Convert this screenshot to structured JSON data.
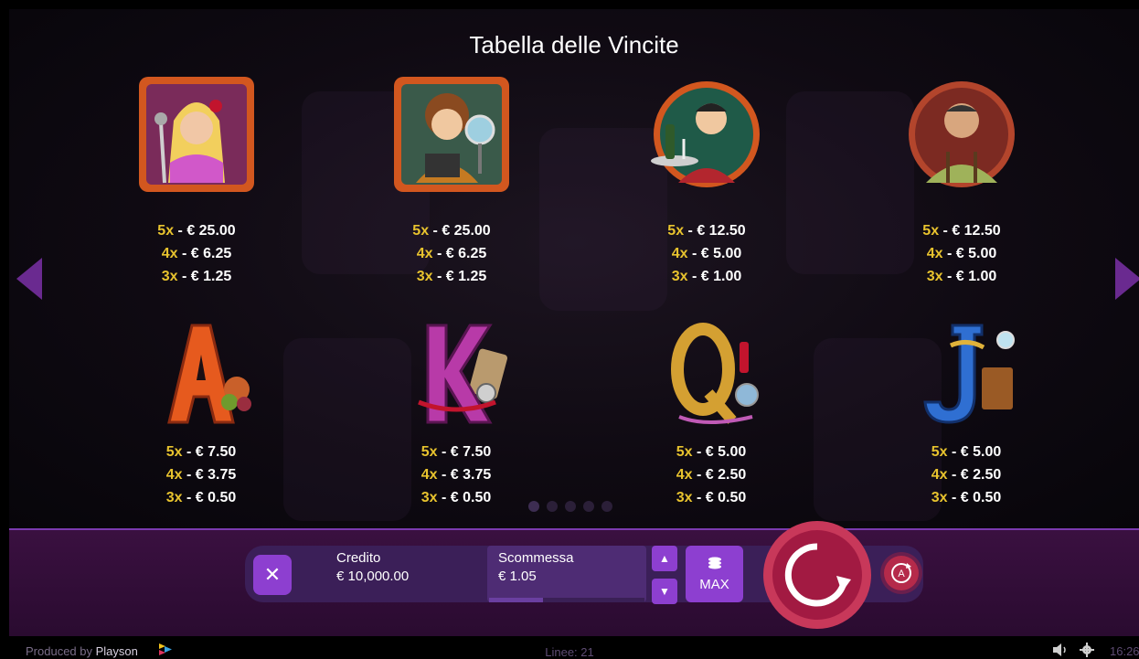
{
  "title": "Tabella delle Vincite",
  "symbols": [
    {
      "name": "singer",
      "pays": [
        {
          "m": "5x",
          "v": " - € 25.00"
        },
        {
          "m": "4x",
          "v": " - € 6.25"
        },
        {
          "m": "3x",
          "v": " - € 1.25"
        }
      ]
    },
    {
      "name": "photographer",
      "pays": [
        {
          "m": "5x",
          "v": " - € 25.00"
        },
        {
          "m": "4x",
          "v": " - € 6.25"
        },
        {
          "m": "3x",
          "v": " - € 1.25"
        }
      ]
    },
    {
      "name": "waiter",
      "pays": [
        {
          "m": "5x",
          "v": " - € 12.50"
        },
        {
          "m": "4x",
          "v": " - € 5.00"
        },
        {
          "m": "3x",
          "v": " - € 1.00"
        }
      ]
    },
    {
      "name": "worker",
      "pays": [
        {
          "m": "5x",
          "v": " - € 12.50"
        },
        {
          "m": "4x",
          "v": " - € 5.00"
        },
        {
          "m": "3x",
          "v": " - € 1.00"
        }
      ]
    },
    {
      "name": "ace",
      "pays": [
        {
          "m": "5x",
          "v": " - € 7.50"
        },
        {
          "m": "4x",
          "v": " - € 3.75"
        },
        {
          "m": "3x",
          "v": " - € 0.50"
        }
      ]
    },
    {
      "name": "king",
      "pays": [
        {
          "m": "5x",
          "v": " - € 7.50"
        },
        {
          "m": "4x",
          "v": " - € 3.75"
        },
        {
          "m": "3x",
          "v": " - € 0.50"
        }
      ]
    },
    {
      "name": "queen",
      "pays": [
        {
          "m": "5x",
          "v": " - € 5.00"
        },
        {
          "m": "4x",
          "v": " - € 2.50"
        },
        {
          "m": "3x",
          "v": " - € 0.50"
        }
      ]
    },
    {
      "name": "jack",
      "pays": [
        {
          "m": "5x",
          "v": " - € 5.00"
        },
        {
          "m": "4x",
          "v": " - € 2.50"
        },
        {
          "m": "3x",
          "v": " - € 0.50"
        }
      ]
    }
  ],
  "pagination": {
    "pages": 5,
    "current": 1
  },
  "controls": {
    "close_label": "✕",
    "credit_label": "Credito",
    "credit_value": "€ 10,000.00",
    "bet_label": "Scommessa",
    "bet_value": "€ 1.05",
    "bet_level_fraction": 0.35,
    "step_up_label": "▲",
    "step_down_label": "▼",
    "max_label": "MAX",
    "autoplay_label": "A"
  },
  "footer": {
    "produced_by": "Produced by",
    "brand": "Playson",
    "lines": "Linee: 21",
    "clock": "16:26"
  },
  "colors": {
    "accent": "#8d3fd0",
    "multiplier": "#e8c32e",
    "spin": "#a21a42",
    "divider": "#7b3ab0"
  }
}
